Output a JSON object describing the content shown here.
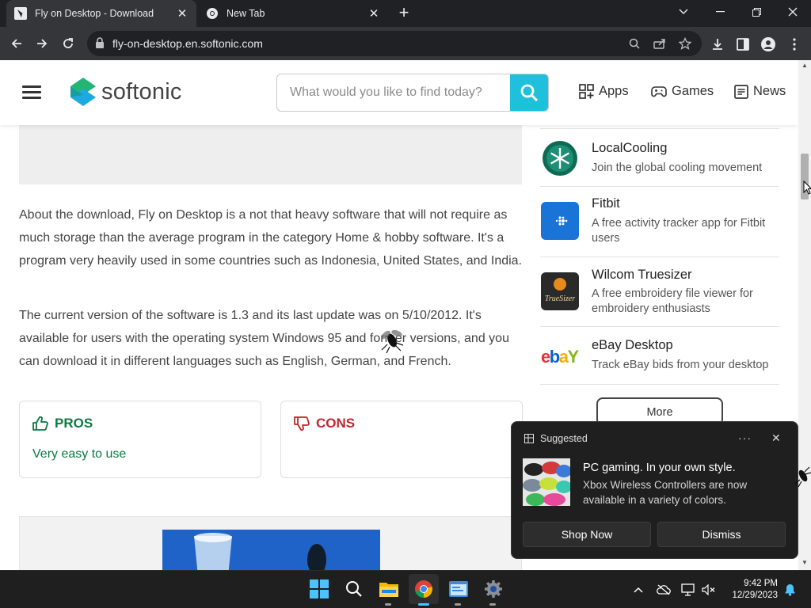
{
  "browser": {
    "tabs": [
      {
        "title": "Fly on Desktop - Download",
        "active": true
      },
      {
        "title": "New Tab",
        "active": false
      }
    ],
    "url": "fly-on-desktop.en.softonic.com"
  },
  "site": {
    "logo_text": "softonic",
    "search_placeholder": "What would you like to find today?",
    "nav": [
      {
        "label": "Apps",
        "icon": "apps-grid-icon"
      },
      {
        "label": "Games",
        "icon": "gamepad-icon"
      },
      {
        "label": "News",
        "icon": "news-icon"
      }
    ]
  },
  "article": {
    "paragraphs": [
      "About the download, Fly on Desktop is a not that heavy software that will not require as much storage than the average program in the category Home & hobby software. It's a program very heavily used in some countries such as Indonesia, United States, and India.",
      "The current version of the software is 1.3 and its last update was on 5/10/2012. It's available for users with the operating system Windows 95 and former versions, and you can download it in different languages such as English, German, and French."
    ],
    "pros": {
      "title": "PROS",
      "items": [
        "Very easy to use"
      ],
      "color": "#0a7a41"
    },
    "cons": {
      "title": "CONS",
      "items": [],
      "color": "#c0262d"
    }
  },
  "sidebar": {
    "apps": [
      {
        "name": "LocalCooling",
        "desc": "Join the global cooling movement",
        "icon": "snowflake-icon"
      },
      {
        "name": "Fitbit",
        "desc": "A free activity tracker app for Fitbit users",
        "icon": "fitbit-icon"
      },
      {
        "name": "Wilcom Truesizer",
        "desc": "A free embroidery file viewer for embroidery enthusiasts",
        "icon": "truesizer-icon",
        "icon_text": "TrueSizer"
      },
      {
        "name": "eBay Desktop",
        "desc": "Track eBay bids from your desktop",
        "icon": "ebay-icon",
        "icon_text": "ebY"
      }
    ],
    "more_label": "More"
  },
  "notification": {
    "header": "Suggested",
    "title": "PC gaming. In your own style.",
    "body": "Xbox Wireless Controllers are now available in a variety of colors.",
    "primary_button": "Shop Now",
    "secondary_button": "Dismiss"
  },
  "taskbar": {
    "time": "9:42 PM",
    "date": "12/29/2023"
  },
  "colors": {
    "accent": "#1ec0dc",
    "pros": "#0a7a41",
    "cons": "#c0262d"
  }
}
